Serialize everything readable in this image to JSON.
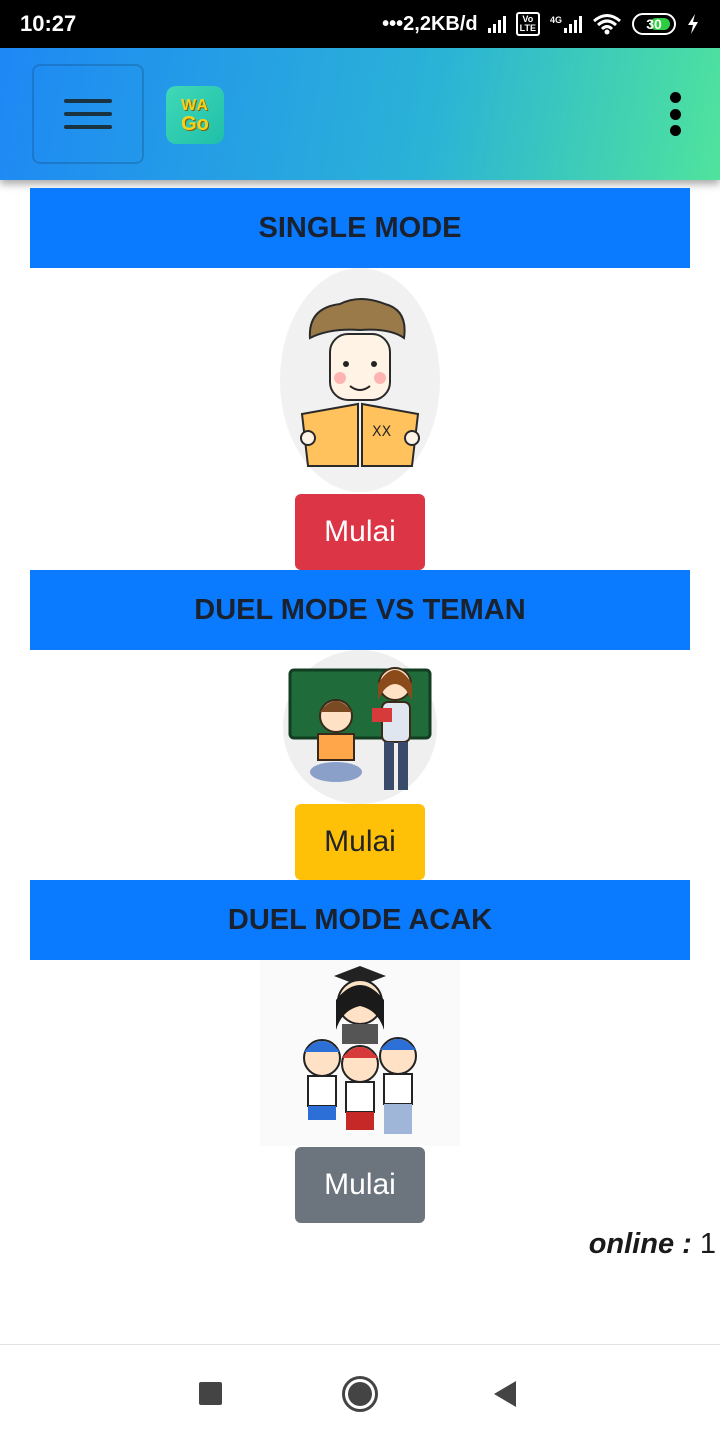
{
  "status_bar": {
    "time": "10:27",
    "network_speed": "•••2,2KB/d",
    "volte": "Vo\nLTE",
    "network_type": "4G",
    "battery": "30",
    "icons": [
      "signal-icon",
      "volte-icon",
      "signal-4g-icon",
      "wifi-icon",
      "battery-icon",
      "charging-icon"
    ]
  },
  "app_bar": {
    "logo_line1": "WA",
    "logo_line2": "Go",
    "icons": [
      "hamburger-menu-icon",
      "app-logo",
      "more-vert-icon"
    ]
  },
  "modes": [
    {
      "title": "SINGLE MODE",
      "button_label": "Mulai",
      "button_color": "#dc3545",
      "illustration": "boy-reading-book"
    },
    {
      "title": "DUEL MODE VS TEMAN",
      "button_label": "Mulai",
      "button_color": "#ffc107",
      "illustration": "two-students-at-blackboard"
    },
    {
      "title": "DUEL MODE ACAK",
      "button_label": "Mulai",
      "button_color": "#6c757d",
      "illustration": "teacher-with-students"
    }
  ],
  "online": {
    "label": "online :",
    "count": "1"
  },
  "nav_bar": {
    "icons": [
      "recent-apps-icon",
      "home-icon",
      "back-icon"
    ]
  },
  "colors": {
    "header_blue": "#0a7bff",
    "appbar_start": "#1e88f5",
    "appbar_end": "#4fe39d"
  }
}
